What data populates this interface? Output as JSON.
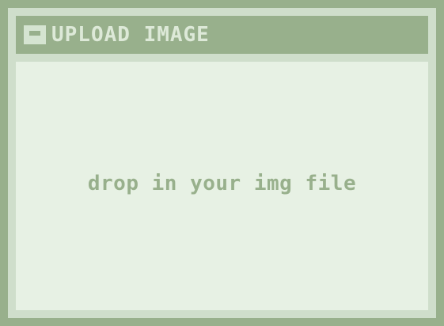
{
  "window": {
    "title": "UPLOAD IMAGE",
    "title_icon": "window-icon"
  },
  "dropzone": {
    "prompt": "drop in your img file"
  },
  "colors": {
    "frame": "#98b08c",
    "panel": "#cfdecb",
    "dropzone_bg": "#e7f1e4",
    "title_text": "#dde9d8",
    "prompt_text": "#98b08c"
  }
}
